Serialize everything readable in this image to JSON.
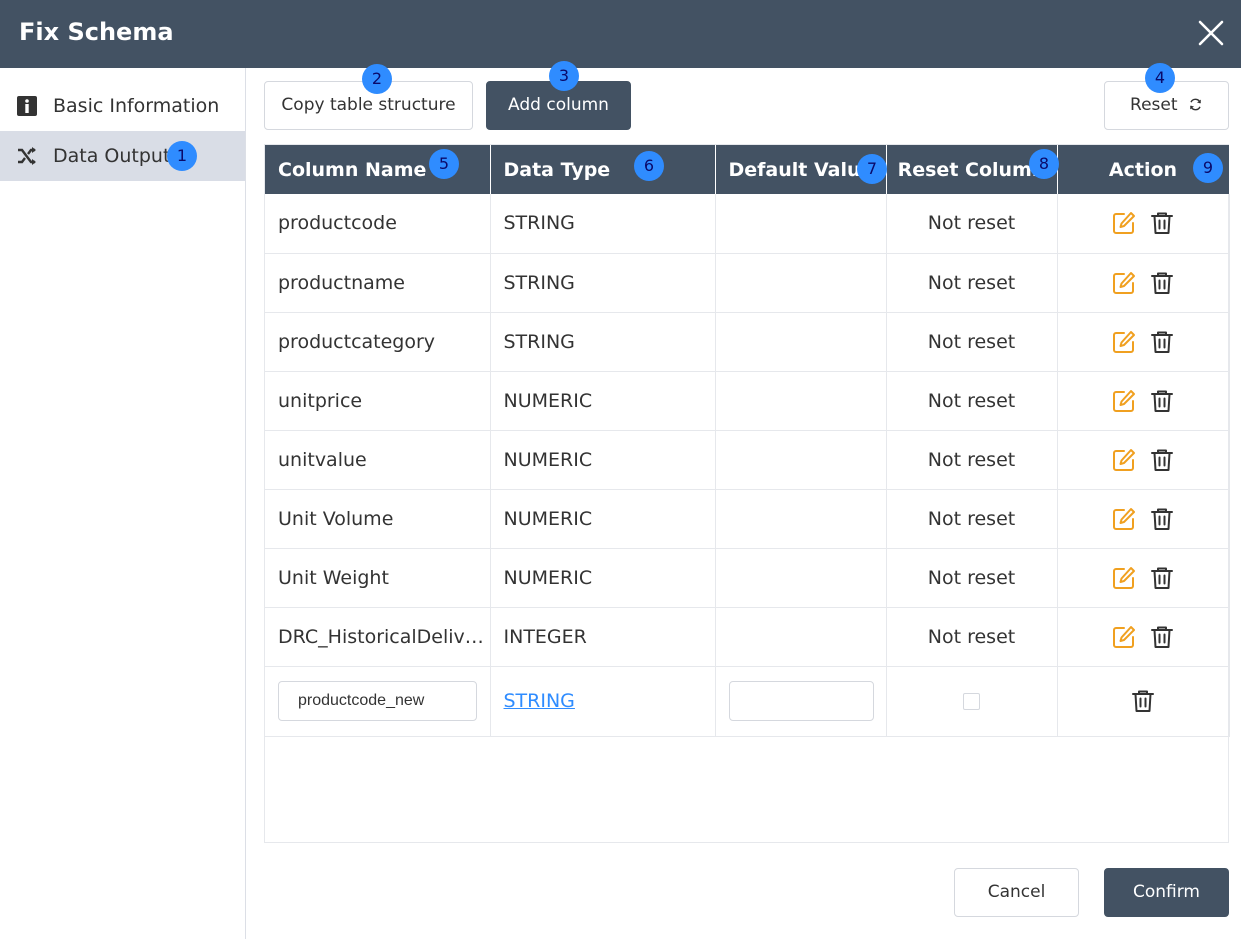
{
  "dialog": {
    "title": "Fix Schema"
  },
  "sidebar": {
    "items": [
      {
        "label": "Basic Information",
        "icon": "info-icon",
        "active": false
      },
      {
        "label": "Data Output",
        "icon": "shuffle-icon",
        "active": true
      }
    ]
  },
  "toolbar": {
    "copy_label": "Copy table structure",
    "add_label": "Add column",
    "reset_label": "Reset"
  },
  "badges": [
    "1",
    "2",
    "3",
    "4",
    "5",
    "6",
    "7",
    "8",
    "9"
  ],
  "table": {
    "headers": [
      "Column Name",
      "Data Type",
      "Default Value",
      "Reset Column",
      "Action"
    ],
    "rows": [
      {
        "name": "productcode",
        "type": "STRING",
        "default": "",
        "reset": "Not reset"
      },
      {
        "name": "productname",
        "type": "STRING",
        "default": "",
        "reset": "Not reset"
      },
      {
        "name": "productcategory",
        "type": "STRING",
        "default": "",
        "reset": "Not reset"
      },
      {
        "name": "unitprice",
        "type": "NUMERIC",
        "default": "",
        "reset": "Not reset"
      },
      {
        "name": "unitvalue",
        "type": "NUMERIC",
        "default": "",
        "reset": "Not reset"
      },
      {
        "name": "Unit Volume",
        "type": "NUMERIC",
        "default": "",
        "reset": "Not reset"
      },
      {
        "name": "Unit Weight",
        "type": "NUMERIC",
        "default": "",
        "reset": "Not reset"
      },
      {
        "name": "DRC_HistoricalDeliver...",
        "type": "INTEGER",
        "default": "",
        "reset": "Not reset"
      }
    ],
    "new_row": {
      "name_value": "productcode_new",
      "type": "STRING",
      "default_value": ""
    }
  },
  "footer": {
    "cancel_label": "Cancel",
    "confirm_label": "Confirm"
  },
  "colors": {
    "header_bg": "#435263",
    "badge": "#2f8cff",
    "edit_icon": "#f0a020",
    "link": "#2f8cff"
  }
}
